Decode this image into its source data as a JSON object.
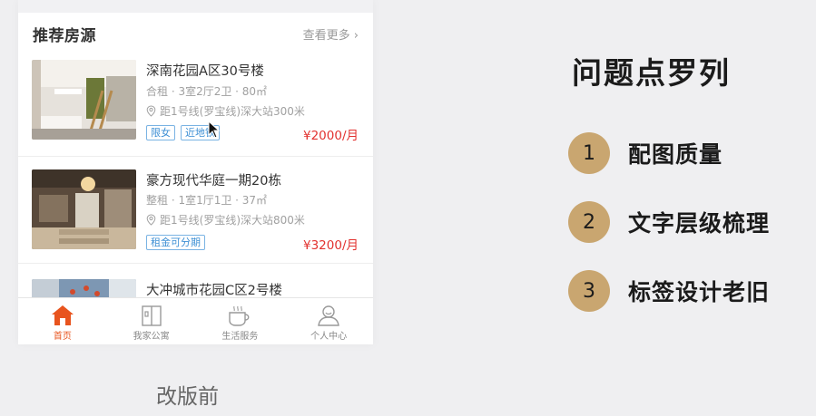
{
  "section": {
    "title": "推荐房源",
    "more": "查看更多 ›"
  },
  "listings": [
    {
      "name": "深南花园A区30号楼",
      "meta": "合租 · 3室2厅2卫 · 80㎡",
      "location": "距1号线(罗宝线)深大站300米",
      "tags": [
        "限女",
        "近地铁"
      ],
      "price": "¥2000/月"
    },
    {
      "name": "豪方现代华庭一期20栋",
      "meta": "整租 · 1室1厅1卫 · 37㎡",
      "location": "距1号线(罗宝线)深大站800米",
      "tags": [
        "租金可分期"
      ],
      "price": "¥3200/月"
    },
    {
      "name": "大冲城市花园C区2号楼"
    }
  ],
  "tabbar": [
    {
      "label": "首页",
      "icon": "home-icon",
      "active": true
    },
    {
      "label": "我家公寓",
      "icon": "apartment-icon",
      "active": false
    },
    {
      "label": "生活服务",
      "icon": "coffee-cup-icon",
      "active": false
    },
    {
      "label": "个人中心",
      "icon": "user-icon",
      "active": false
    }
  ],
  "caption": "改版前",
  "issues": {
    "title": "问题点罗列",
    "items": [
      {
        "num": "1",
        "text": "配图质量"
      },
      {
        "num": "2",
        "text": "文字层级梳理"
      },
      {
        "num": "3",
        "text": "标签设计老旧"
      }
    ]
  },
  "colors": {
    "accent_orange": "#e8541e",
    "price_red": "#e2322f",
    "tag_blue": "#3d8fd4",
    "badge_gold": "#c9a670"
  }
}
